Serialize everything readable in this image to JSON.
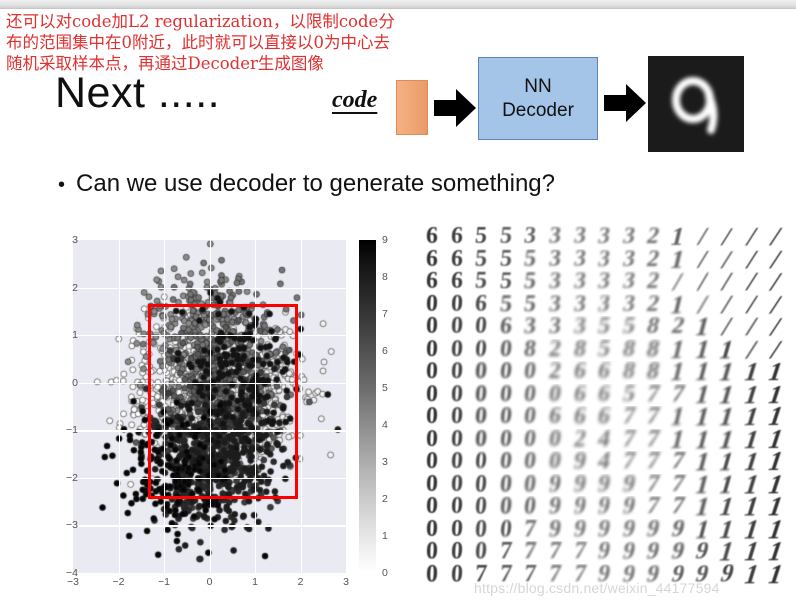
{
  "slide": {
    "annotation_text": "还可以对code加L2 regularization，以限制code分\n布的范围集中在0附近，此时就可以直接以0为中心去\n随机采取样本点，再通过Decoder生成图像",
    "annotation_color": "#e03030",
    "title": "Next .....",
    "bullet_dot": "•",
    "bullet_text": "Can we use decoder to generate something?",
    "watermark": "https://blog.csdn.net/weixin_44177594"
  },
  "pipeline": {
    "code_label": "code",
    "code_bar_color": "#f0a878",
    "arrow1_name": "right-arrow",
    "arrow2_name": "right-arrow",
    "decoder_line1": "NN",
    "decoder_line2": "Decoder",
    "decoder_box_color": "#a4c5e8",
    "output_digit": "9",
    "output_bg": "#1b1b1b"
  },
  "chart_data": {
    "type": "scatter",
    "title": "",
    "xlabel": "",
    "ylabel": "",
    "xlim": [
      -3,
      3
    ],
    "ylim": [
      -4,
      3
    ],
    "xticks": [
      "-3",
      "-2",
      "-1",
      "0",
      "1",
      "2",
      "3"
    ],
    "yticks": [
      "3",
      "2",
      "1",
      "0",
      "-1",
      "-2",
      "-3",
      "-4"
    ],
    "grid": true,
    "background": "#eaeaf2",
    "gridline_color": "#ffffff",
    "colorbar": {
      "label": "",
      "vmin": 0,
      "vmax": 9,
      "ticks": [
        "9",
        "8",
        "7",
        "6",
        "5",
        "4",
        "3",
        "2",
        "1",
        "0"
      ],
      "cmap": "gray_reversed"
    },
    "highlight_box": {
      "color": "#ff0000",
      "x0": -1.35,
      "x1": 1.95,
      "y0": -2.45,
      "y1": 1.65,
      "linewidth": 3.5
    },
    "clusters": [
      {
        "label": "0",
        "cx": -0.55,
        "cy": -0.15,
        "n": 420,
        "shade": "#fdfdfd"
      },
      {
        "label": "1",
        "cx": 0.95,
        "cy": -0.25,
        "n": 400,
        "shade": "#f2f2f2"
      },
      {
        "label": "2",
        "cx": -0.25,
        "cy": 1.05,
        "n": 220,
        "shade": "#8c8c8c"
      },
      {
        "label": "3",
        "cx": 0.35,
        "cy": 0.85,
        "n": 200,
        "shade": "#767676"
      },
      {
        "label": "4",
        "cx": 0.25,
        "cy": -0.45,
        "n": 230,
        "shade": "#5a5a5a"
      },
      {
        "label": "5",
        "cx": 0.15,
        "cy": -1.25,
        "n": 210,
        "shade": "#3c3c3c"
      },
      {
        "label": "6",
        "cx": -0.15,
        "cy": -1.85,
        "n": 190,
        "shade": "#2a2a2a"
      },
      {
        "label": "7",
        "cx": 0.45,
        "cy": -1.55,
        "n": 200,
        "shade": "#1c1c1c"
      },
      {
        "label": "8",
        "cx": 0.55,
        "cy": 0.15,
        "n": 180,
        "shade": "#121212"
      },
      {
        "label": "9",
        "cx": -0.75,
        "cy": -2.05,
        "n": 170,
        "shade": "#050505"
      }
    ]
  },
  "digit_grid": {
    "rows": 16,
    "cols": 15,
    "caption": "",
    "glyphs": [
      [
        "6",
        "6",
        "5",
        "5",
        "3",
        "3",
        "3",
        "3",
        "3",
        "2",
        "1",
        "/",
        "/",
        "/",
        "/"
      ],
      [
        "6",
        "6",
        "5",
        "5",
        "5",
        "3",
        "3",
        "3",
        "3",
        "2",
        "1",
        "/",
        "/",
        "/",
        "/"
      ],
      [
        "6",
        "6",
        "5",
        "5",
        "5",
        "3",
        "3",
        "3",
        "3",
        "2",
        "/",
        "/",
        "/",
        "/",
        "/"
      ],
      [
        "0",
        "0",
        "6",
        "5",
        "5",
        "3",
        "3",
        "3",
        "3",
        "2",
        "1",
        "/",
        "/",
        "/",
        "/"
      ],
      [
        "0",
        "0",
        "0",
        "6",
        "3",
        "3",
        "3",
        "5",
        "5",
        "8",
        "2",
        "1",
        "/",
        "/",
        "/"
      ],
      [
        "0",
        "0",
        "0",
        "0",
        "8",
        "2",
        "8",
        "5",
        "8",
        "8",
        "1",
        "1",
        "1",
        "/",
        "/"
      ],
      [
        "0",
        "0",
        "0",
        "0",
        "0",
        "2",
        "6",
        "6",
        "8",
        "8",
        "1",
        "1",
        "1",
        "1",
        "1"
      ],
      [
        "0",
        "0",
        "0",
        "0",
        "0",
        "0",
        "6",
        "6",
        "5",
        "7",
        "7",
        "1",
        "1",
        "1",
        "1"
      ],
      [
        "0",
        "0",
        "0",
        "0",
        "0",
        "6",
        "6",
        "6",
        "7",
        "7",
        "1",
        "1",
        "1",
        "1",
        "1"
      ],
      [
        "0",
        "0",
        "0",
        "0",
        "0",
        "0",
        "2",
        "4",
        "7",
        "7",
        "1",
        "1",
        "1",
        "1",
        "1"
      ],
      [
        "0",
        "0",
        "0",
        "0",
        "0",
        "0",
        "9",
        "4",
        "7",
        "7",
        "7",
        "1",
        "1",
        "1",
        "1"
      ],
      [
        "0",
        "0",
        "0",
        "0",
        "0",
        "9",
        "9",
        "9",
        "9",
        "7",
        "7",
        "1",
        "1",
        "1",
        "1"
      ],
      [
        "0",
        "0",
        "0",
        "0",
        "0",
        "9",
        "9",
        "9",
        "9",
        "7",
        "7",
        "1",
        "1",
        "1",
        "1"
      ],
      [
        "0",
        "0",
        "0",
        "0",
        "7",
        "9",
        "9",
        "9",
        "9",
        "9",
        "9",
        "1",
        "1",
        "1",
        "1"
      ],
      [
        "0",
        "0",
        "0",
        "7",
        "7",
        "7",
        "7",
        "9",
        "9",
        "9",
        "9",
        "9",
        "1",
        "1",
        "1"
      ],
      [
        "0",
        "0",
        "7",
        "7",
        "7",
        "7",
        "7",
        "9",
        "9",
        "9",
        "9",
        "9",
        "9",
        "1",
        "1"
      ]
    ]
  }
}
